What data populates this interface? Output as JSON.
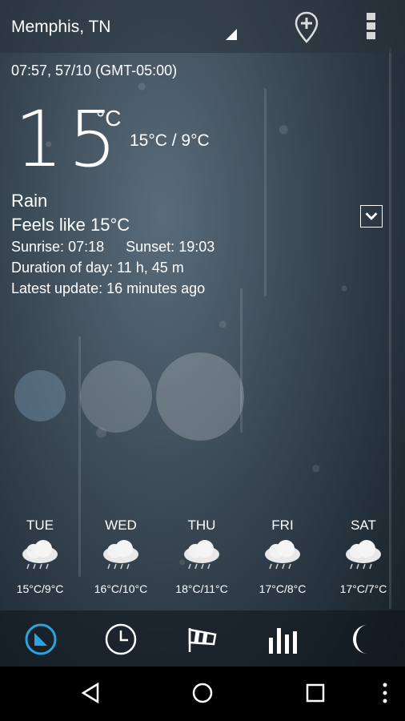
{
  "header": {
    "city": "Memphis, TN",
    "icons": [
      "dropdown-triangle-icon",
      "add-location-pin-icon",
      "overflow-menu-icon"
    ]
  },
  "current": {
    "datetime": "07:57, 57/10 (GMT-05:00)",
    "temperature": "15",
    "unit": "°C",
    "hi_lo": "15°C / 9°C",
    "condition": "Rain",
    "feels_like": "Feels like 15°C",
    "sunrise_label": "Sunrise:",
    "sunrise": "07:18",
    "sunset_label": "Sunset:",
    "sunset": "19:03",
    "duration": "Duration of day: 11 h, 45 m",
    "latest_update": "Latest update: 16 minutes ago"
  },
  "forecast": [
    {
      "day": "TUE",
      "temps": "15°C/9°C",
      "icon": "rain-cloud-icon"
    },
    {
      "day": "WED",
      "temps": "16°C/10°C",
      "icon": "rain-cloud-icon"
    },
    {
      "day": "THU",
      "temps": "18°C/11°C",
      "icon": "rain-cloud-icon"
    },
    {
      "day": "FRI",
      "temps": "17°C/8°C",
      "icon": "rain-cloud-icon"
    },
    {
      "day": "SAT",
      "temps": "17°C/7°C",
      "icon": "rain-cloud-icon"
    }
  ],
  "bottom_nav": {
    "items": [
      "now-clock-icon",
      "hourly-clock-icon",
      "windsock-icon",
      "bar-chart-icon",
      "moon-icon"
    ],
    "active": "now-clock-icon",
    "active_color": "#2aa3e0"
  },
  "system_nav": [
    "back-icon",
    "home-icon",
    "recents-icon",
    "menu-icon"
  ]
}
